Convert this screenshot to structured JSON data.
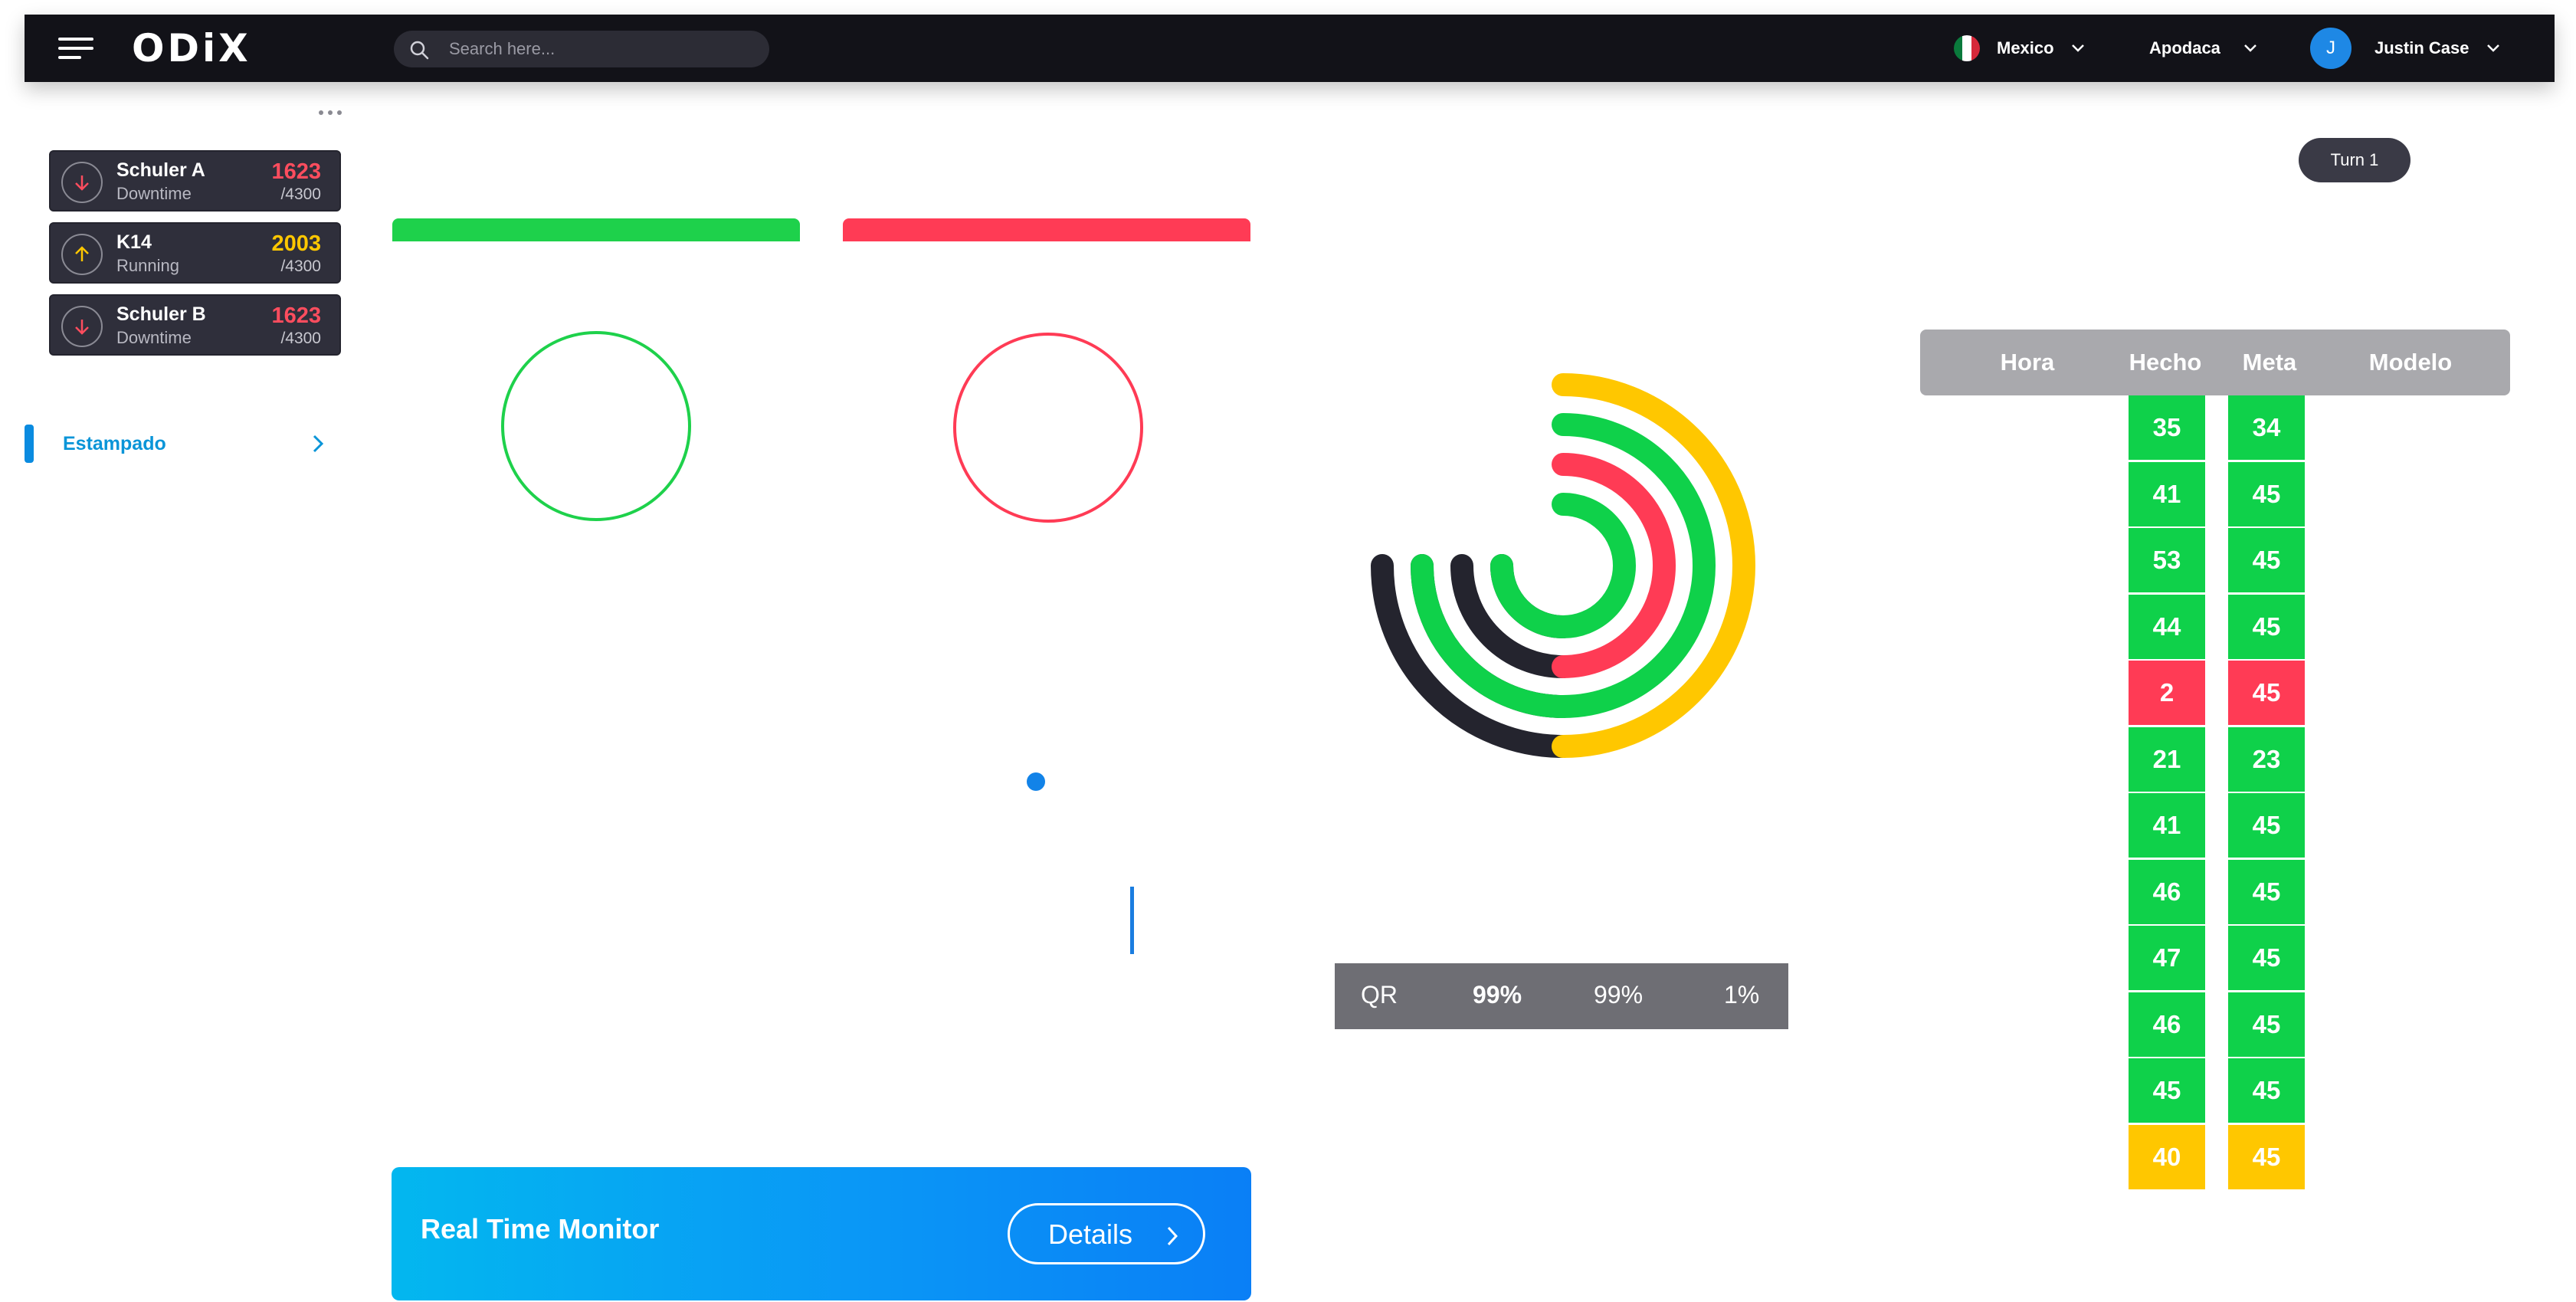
{
  "header": {
    "logo": "ODiX",
    "search_placeholder": "Search here...",
    "country": "Mexico",
    "plant": "Apodaca",
    "user_initial": "J",
    "user_name": "Justin Case"
  },
  "machines": [
    {
      "name": "Schuler A",
      "status": "Downtime",
      "value": "1623",
      "total": "/4300",
      "direction": "down",
      "color": "#ff4d5e"
    },
    {
      "name": "K14",
      "status": "Running",
      "value": "2003",
      "total": "/4300",
      "direction": "up",
      "color": "#ffc700"
    },
    {
      "name": "Schuler B",
      "status": "Downtime",
      "value": "1623",
      "total": "/4300",
      "direction": "down",
      "color": "#ff4d5e"
    }
  ],
  "sidebar": {
    "nav_label": "Estampado"
  },
  "turn_label": "Turn 1",
  "status_bars": {
    "left_color": "#1ed14b",
    "right_color": "#ff3b55"
  },
  "radial_chart": {
    "rings": [
      {
        "fraction": 0.5,
        "color": "#ffc700"
      },
      {
        "fraction": 0.75,
        "color": "#0fd14a"
      },
      {
        "fraction": 0.5,
        "color": "#ff3b55"
      },
      {
        "fraction": 0.75,
        "color": "#0fd14a"
      }
    ],
    "track_color": "#24242e"
  },
  "qr": {
    "label": "QR",
    "v1": "99%",
    "v2": "99%",
    "v3": "1%"
  },
  "table": {
    "headers": {
      "hora": "Hora",
      "hecho": "Hecho",
      "meta": "Meta",
      "modelo": "Modelo"
    },
    "rows": [
      {
        "hecho": "35",
        "meta": "34",
        "color": "#0fd14a"
      },
      {
        "hecho": "41",
        "meta": "45",
        "color": "#0fd14a"
      },
      {
        "hecho": "53",
        "meta": "45",
        "color": "#0fd14a"
      },
      {
        "hecho": "44",
        "meta": "45",
        "color": "#0fd14a"
      },
      {
        "hecho": "2",
        "meta": "45",
        "color": "#ff3b55"
      },
      {
        "hecho": "21",
        "meta": "23",
        "color": "#0fd14a"
      },
      {
        "hecho": "41",
        "meta": "45",
        "color": "#0fd14a"
      },
      {
        "hecho": "46",
        "meta": "45",
        "color": "#0fd14a"
      },
      {
        "hecho": "47",
        "meta": "45",
        "color": "#0fd14a"
      },
      {
        "hecho": "46",
        "meta": "45",
        "color": "#0fd14a"
      },
      {
        "hecho": "45",
        "meta": "45",
        "color": "#0fd14a"
      },
      {
        "hecho": "40",
        "meta": "45",
        "color": "#ffc700"
      }
    ]
  },
  "monitor": {
    "title": "Real Time Monitor",
    "button": "Details"
  }
}
